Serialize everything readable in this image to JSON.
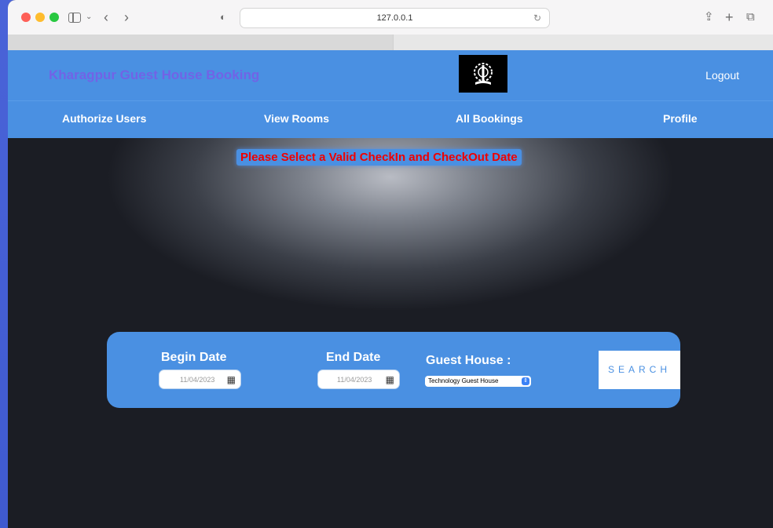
{
  "browser": {
    "url": "127.0.0.1"
  },
  "header": {
    "brand": "Kharagpur Guest House Booking",
    "logout": "Logout"
  },
  "nav": {
    "items": [
      "Authorize Users",
      "View Rooms",
      "All Bookings",
      "Profile"
    ]
  },
  "alert": {
    "message": "Please Select a Valid CheckIn and CheckOut Date"
  },
  "search": {
    "begin_label": "Begin Date",
    "begin_value": "11/04/2023",
    "end_label": "End Date",
    "end_value": "11/04/2023",
    "guest_house_label": "Guest House :",
    "guest_house_value": "Technology Guest House",
    "button": "SEARCH"
  },
  "colors": {
    "primary": "#4a90e2",
    "alert_text": "#f00000",
    "brand_text": "#7f55e8"
  }
}
